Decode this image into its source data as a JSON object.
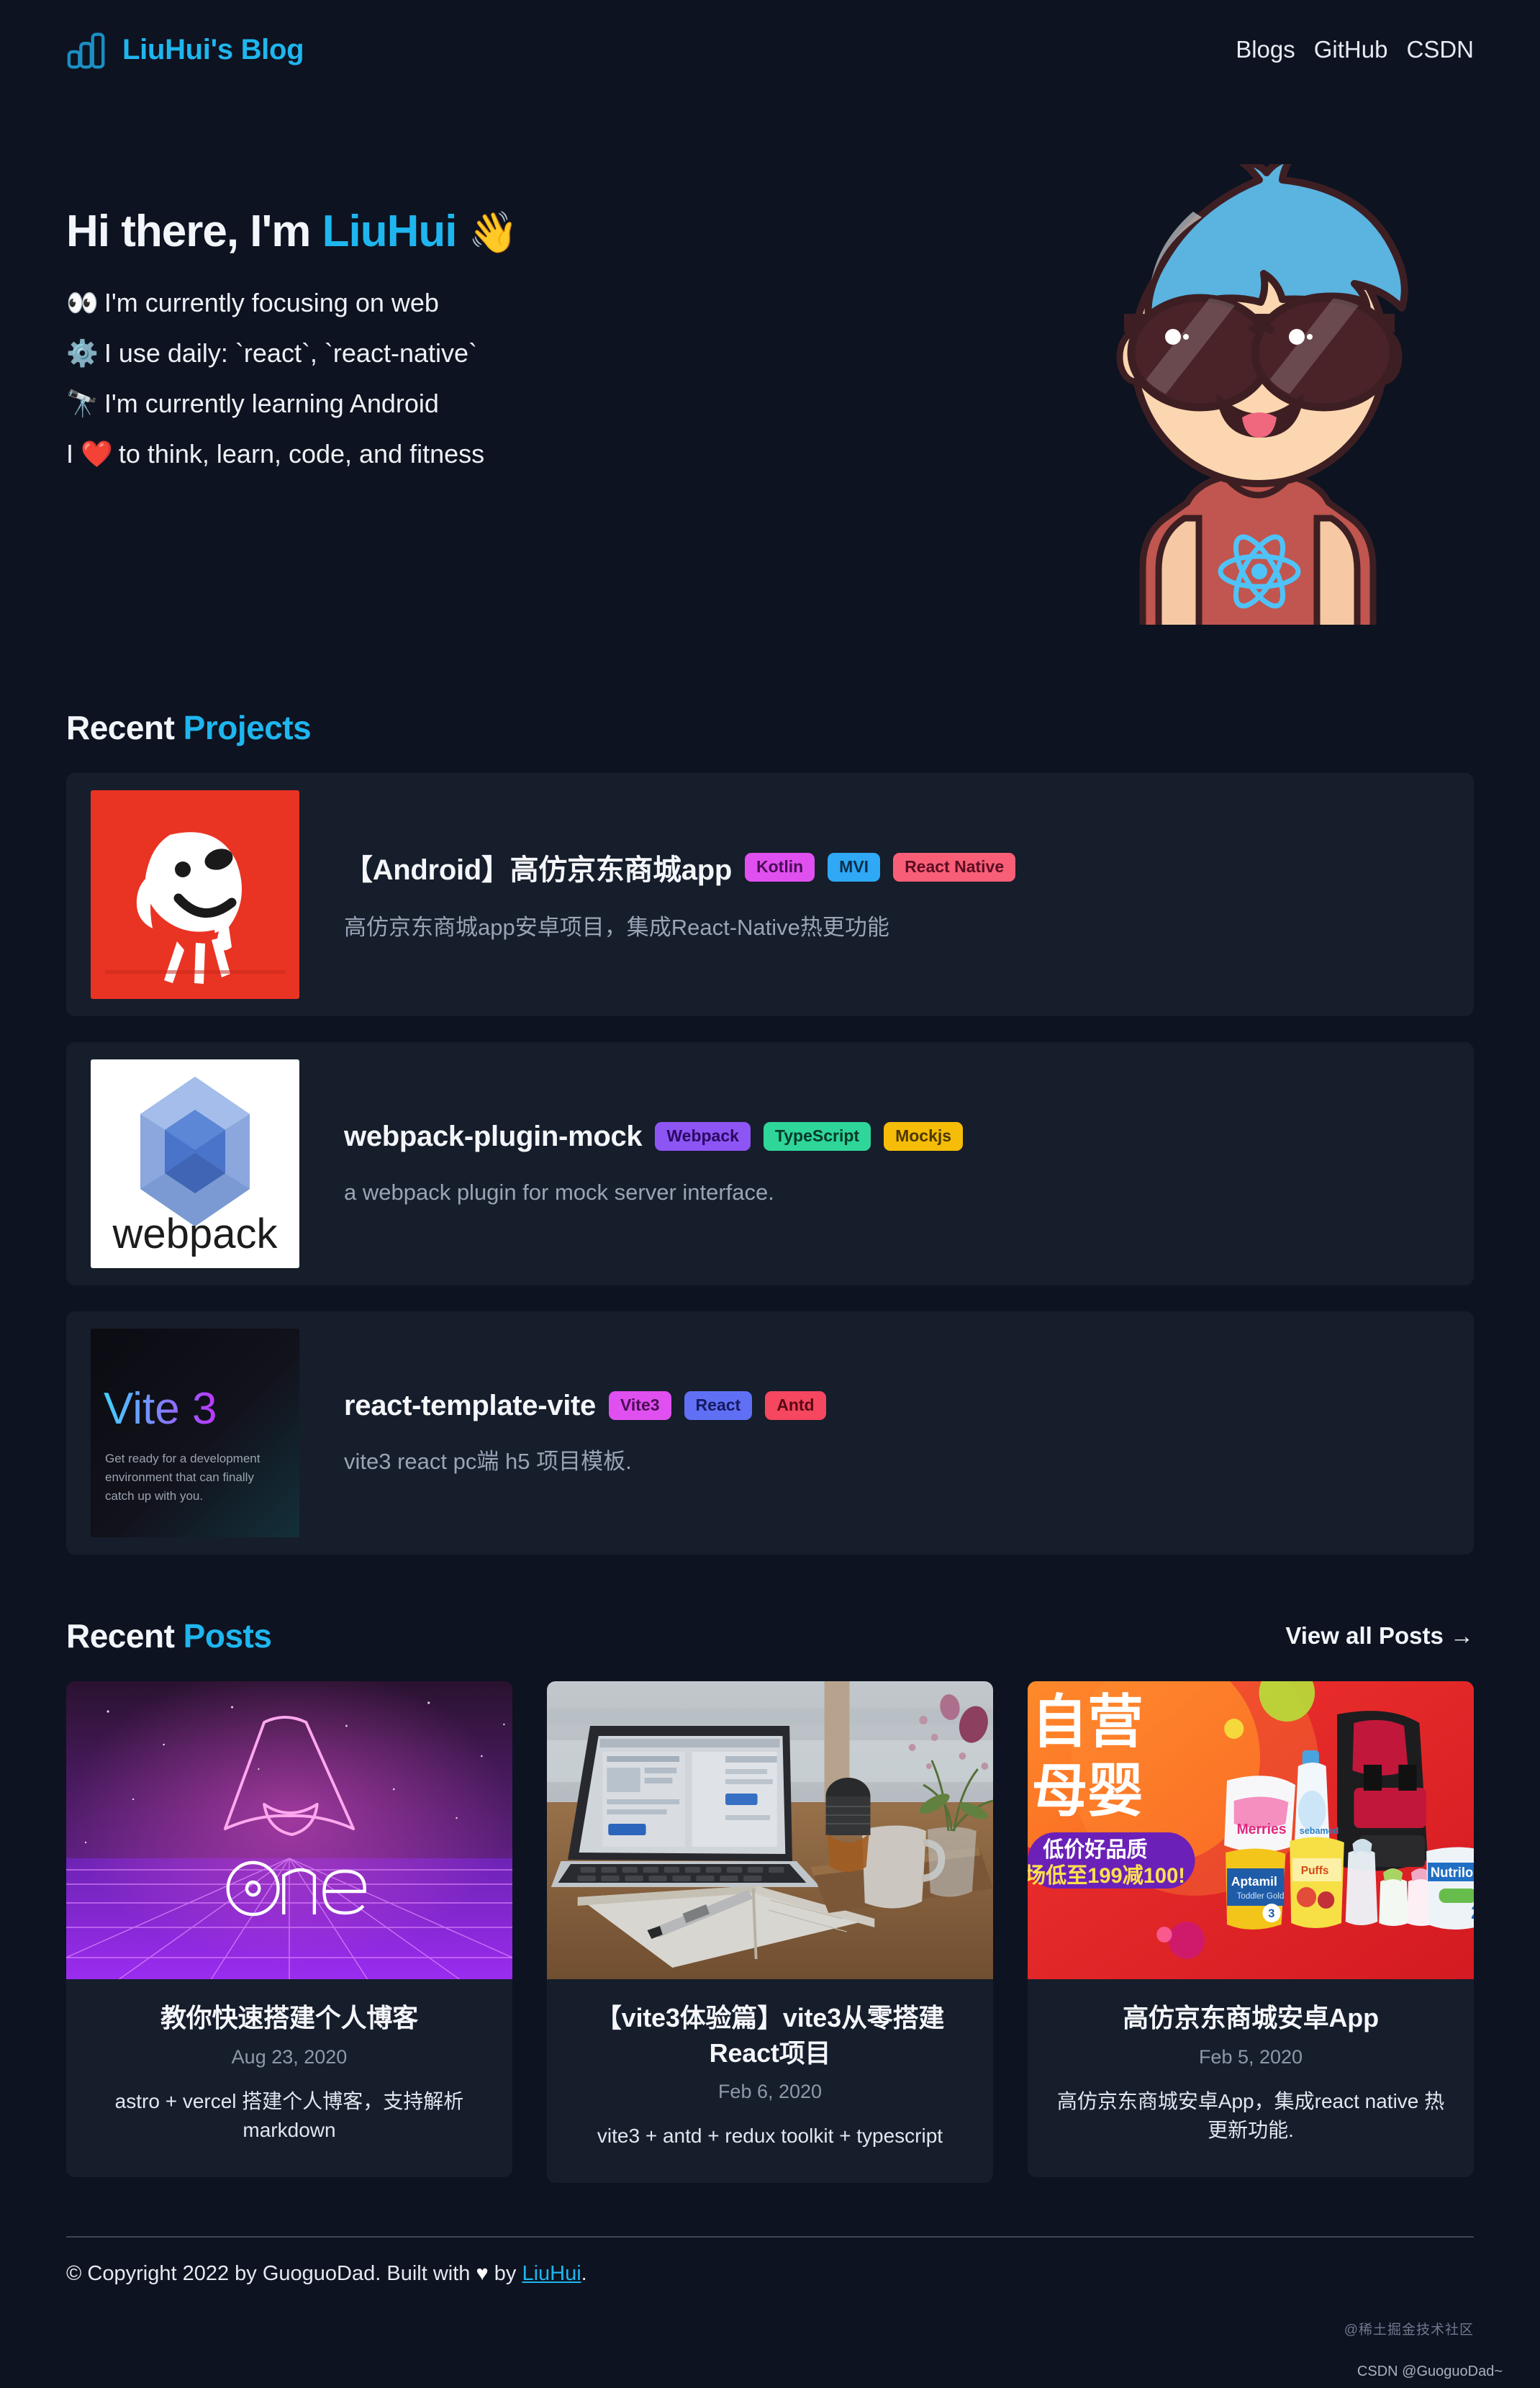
{
  "header": {
    "logo_icon": "bar-chart-icon",
    "brand": "LiuHui's Blog",
    "nav": [
      {
        "label": "Blogs"
      },
      {
        "label": "GitHub"
      },
      {
        "label": "CSDN"
      }
    ]
  },
  "hero": {
    "greeting_prefix": "Hi there, I'm ",
    "name": "LiuHui",
    "wave_emoji": "👋",
    "lines": [
      {
        "icon": "👀",
        "icon_name": "eyes-emoji",
        "text": "I'm currently focusing on web"
      },
      {
        "icon": "⚙️",
        "icon_name": "gear-emoji",
        "text": "I use daily: `react`, `react-native`"
      },
      {
        "icon": "🔭",
        "icon_name": "telescope-emoji",
        "text": "I'm currently learning Android"
      },
      {
        "icon": "❤️",
        "icon_name": "heart-emoji",
        "text": "to think, learn, code, and fitness",
        "prefix": "I "
      }
    ],
    "avatar_alt": "cartoon-avatar-blue-hair-sunglasses-react-shirt"
  },
  "projects_section": {
    "title_plain": "Recent ",
    "title_accent": "Projects",
    "items": [
      {
        "thumb": "jd-joy-dog-logo",
        "title": "【Android】高仿京东商城app",
        "description": "高仿京东商城app安卓项目，集成React-Native热更功能",
        "tags": [
          {
            "label": "Kotlin",
            "bg": "#e050f0",
            "fg": "#4a0d55"
          },
          {
            "label": "MVI",
            "bg": "#2fa8f5",
            "fg": "#0a2f4d"
          },
          {
            "label": "React Native",
            "bg": "#f85f77",
            "fg": "#5c0d22"
          }
        ]
      },
      {
        "thumb": "webpack-logo",
        "title": "webpack-plugin-mock",
        "description": "a webpack plugin for mock server interface.",
        "tags": [
          {
            "label": "Webpack",
            "bg": "#8e55f5",
            "fg": "#2a0a63"
          },
          {
            "label": "TypeScript",
            "bg": "#2fd699",
            "fg": "#05392a"
          },
          {
            "label": "Mockjs",
            "bg": "#f5bd07",
            "fg": "#4d3800"
          }
        ]
      },
      {
        "thumb": "vite3-banner",
        "thumb_title": "Vite 3",
        "thumb_sub": "Get ready for a development environment that can finally catch up with you.",
        "title": "react-template-vite",
        "description": "vite3 react pc端 h5 项目模板.",
        "tags": [
          {
            "label": "Vite3",
            "bg": "#e050f0",
            "fg": "#4a0d55"
          },
          {
            "label": "React",
            "bg": "#6070f5",
            "fg": "#151a60"
          },
          {
            "label": "Antd",
            "bg": "#f5475f",
            "fg": "#5c0716"
          }
        ]
      }
    ]
  },
  "posts_section": {
    "title_plain": "Recent ",
    "title_accent": "Posts",
    "view_all": "View all Posts →",
    "items": [
      {
        "cover": "astro-one-neon-grid",
        "title": "教你快速搭建个人博客",
        "date": "Aug 23, 2020",
        "excerpt": "astro + vercel 搭建个人博客，支持解析 markdown"
      },
      {
        "cover": "desk-laptop-notebook-coffee-photo",
        "title": "【vite3体验篇】vite3从零搭建React项目",
        "date": "Feb 6, 2020",
        "excerpt": "vite3 + antd + redux toolkit + typescript"
      },
      {
        "cover": "jd-mother-baby-promo-banner",
        "cover_text_main": "自营母婴",
        "cover_text_sub": "低价好品质",
        "cover_text_price": "场低至199减100!",
        "title": "高仿京东商城安卓App",
        "date": "Feb 5, 2020",
        "excerpt": "高仿京东商城安卓App，集成react native 热更新功能."
      }
    ]
  },
  "footer": {
    "copyright_pre": "© Copyright 2022 by GuoguoDad. Built with ",
    "heart": "♥",
    "copyright_mid": " by ",
    "author": "LiuHui",
    "copyright_post": ".",
    "watermark_top": "@稀土掘金技术社区",
    "watermark_bottom": "CSDN @GuoguoDad~"
  },
  "colors": {
    "page_bg": "#0d1320",
    "card_bg": "#161d2b",
    "accent": "#1fb6ef",
    "text": "#f2f5fa",
    "muted": "#9aa4b5"
  }
}
